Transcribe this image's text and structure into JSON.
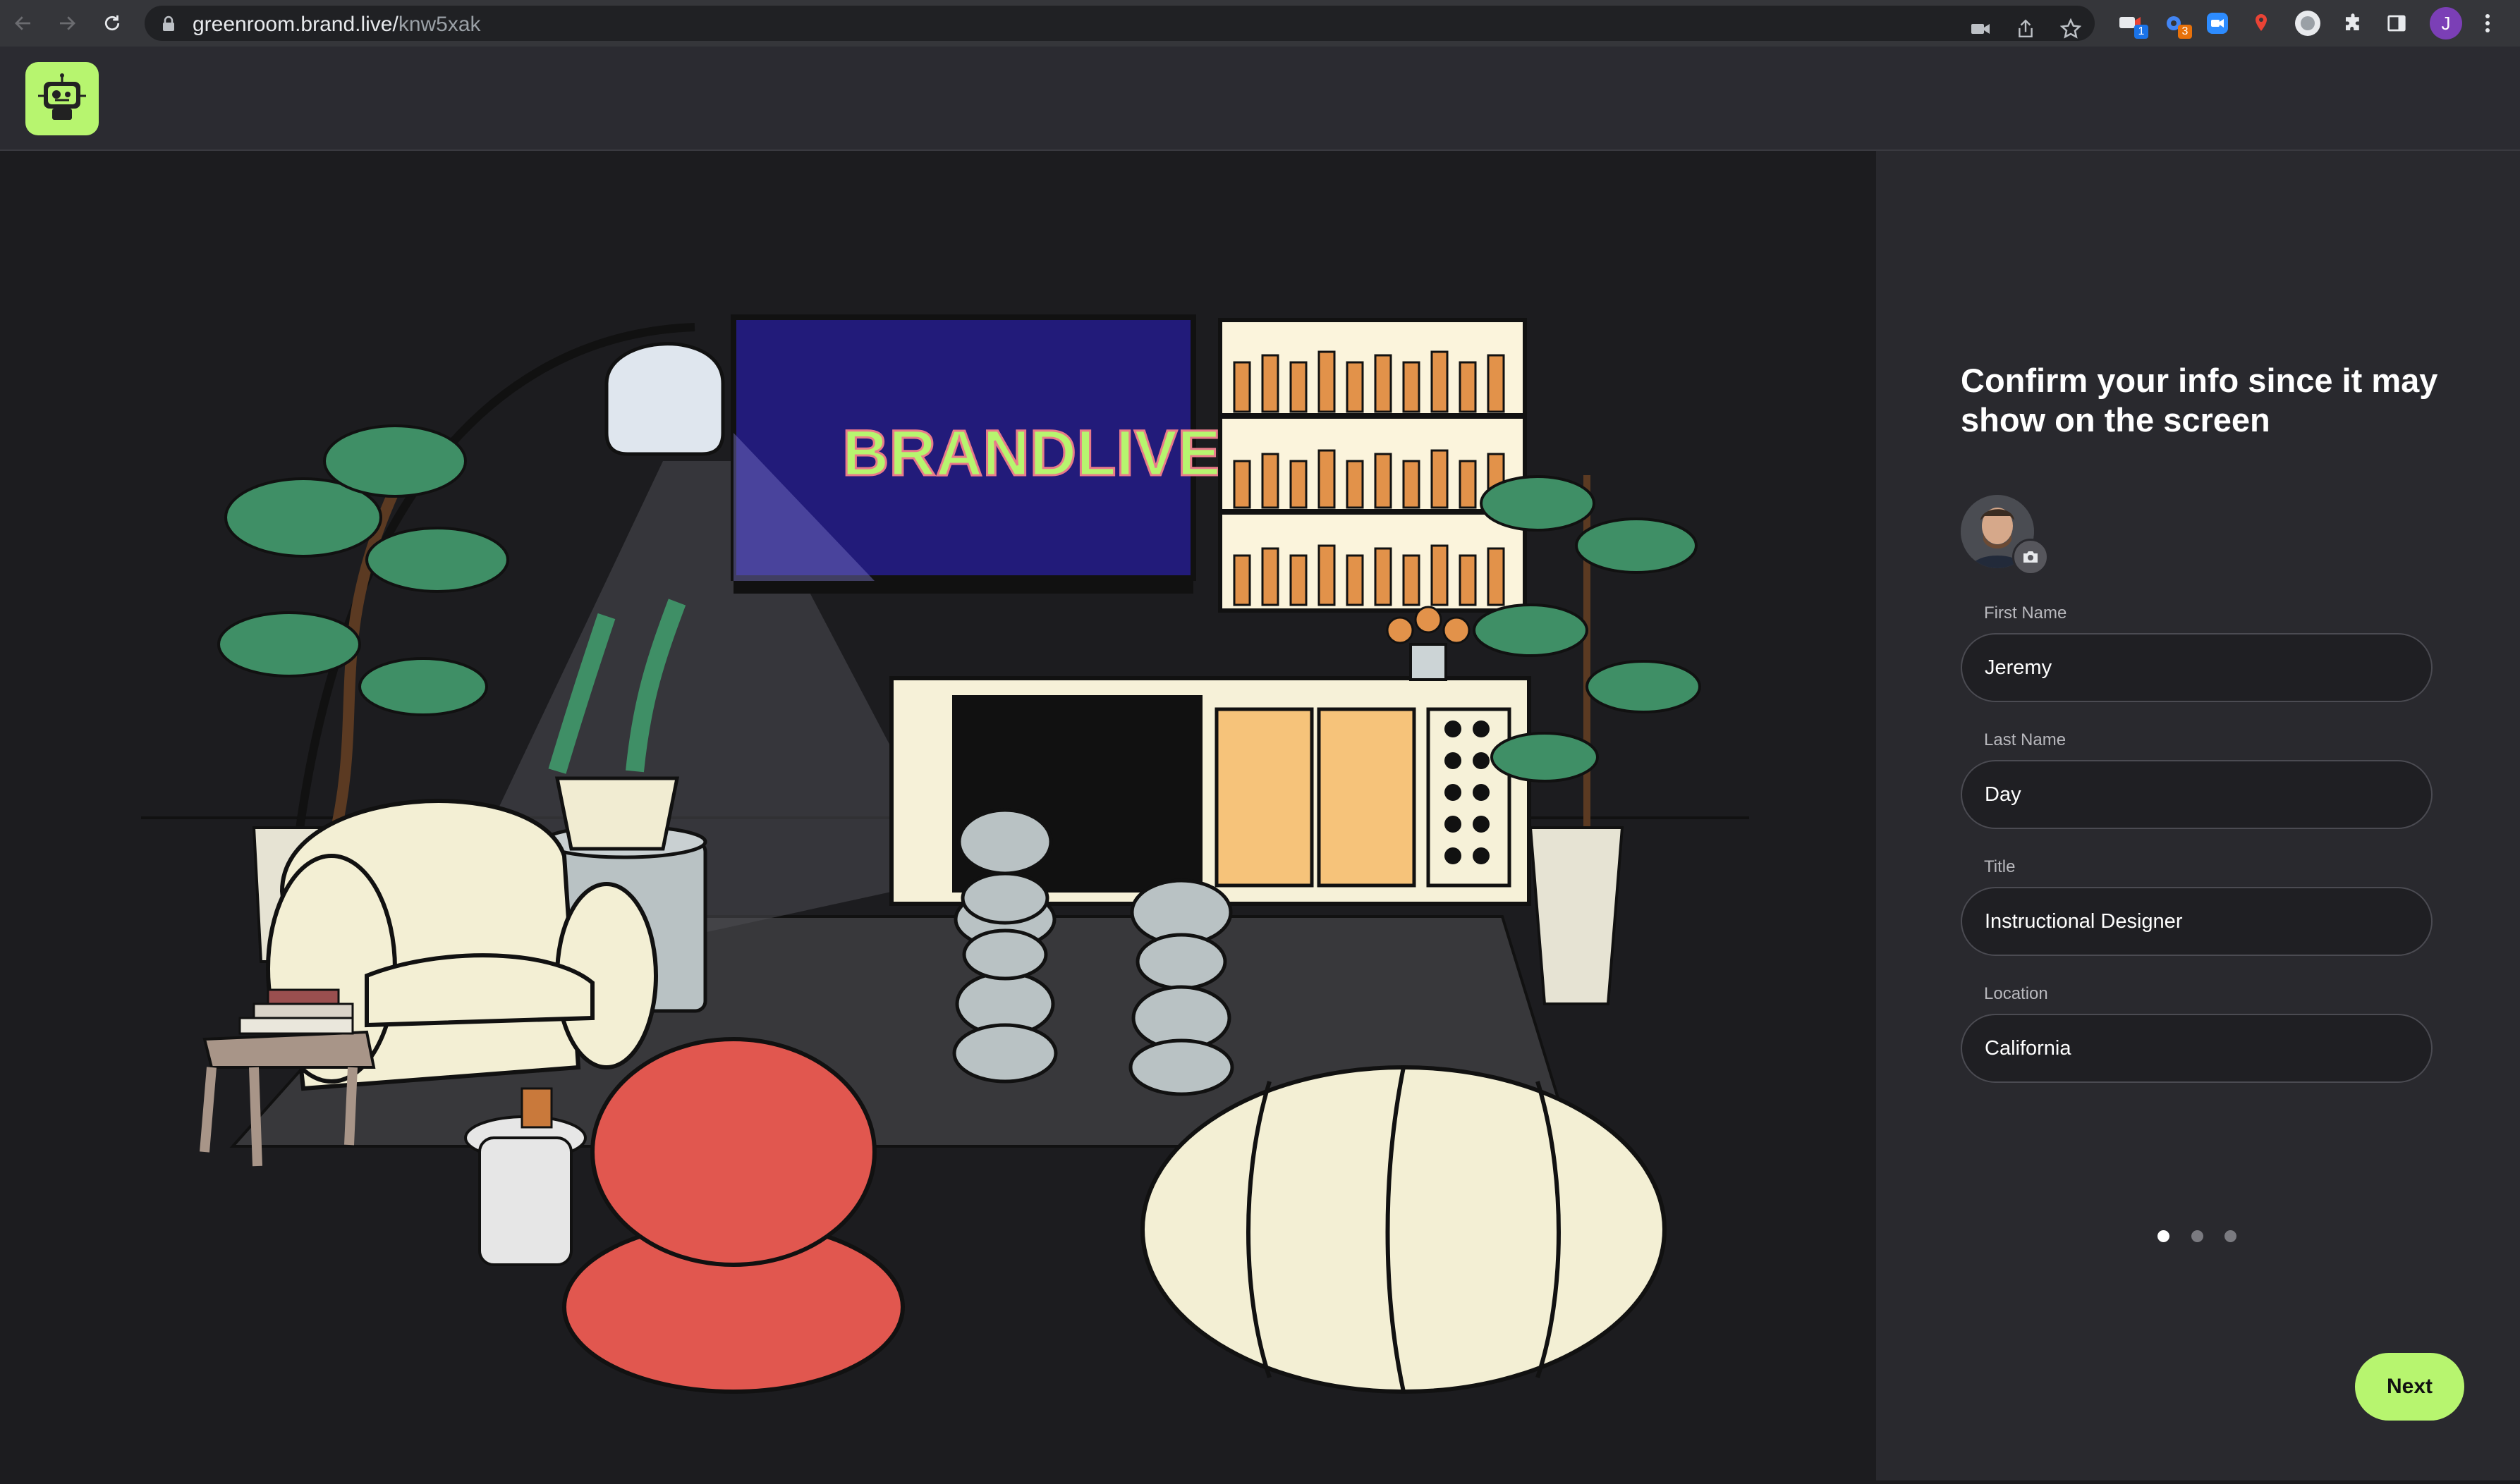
{
  "browser": {
    "url_host": "greenroom.brand.live/",
    "url_path": "knw5xak",
    "extensions": [
      {
        "name": "ext-1",
        "badge": "1",
        "color": "#8ab4f8"
      },
      {
        "name": "ext-2",
        "badge": "3",
        "color": "#e8710a"
      },
      {
        "name": "zoom",
        "badge": "",
        "color": "#2d8cff"
      },
      {
        "name": "ext-4",
        "badge": "",
        "color": "#ea4335"
      }
    ],
    "profile_initial": "J"
  },
  "app": {
    "logo": "brandlive-robot-logo",
    "brand_color": "#b7f56f"
  },
  "scene": {
    "tv_brand_text": "BRANDLIVE"
  },
  "form": {
    "heading": "Confirm your info since it may show on the screen",
    "fields": [
      {
        "label": "First Name",
        "value": "Jeremy"
      },
      {
        "label": "Last Name",
        "value": "Day"
      },
      {
        "label": "Title",
        "value": "Instructional Designer"
      },
      {
        "label": "Location",
        "value": "California"
      }
    ],
    "step_current": 1,
    "step_total": 3,
    "next_label": "Next"
  }
}
